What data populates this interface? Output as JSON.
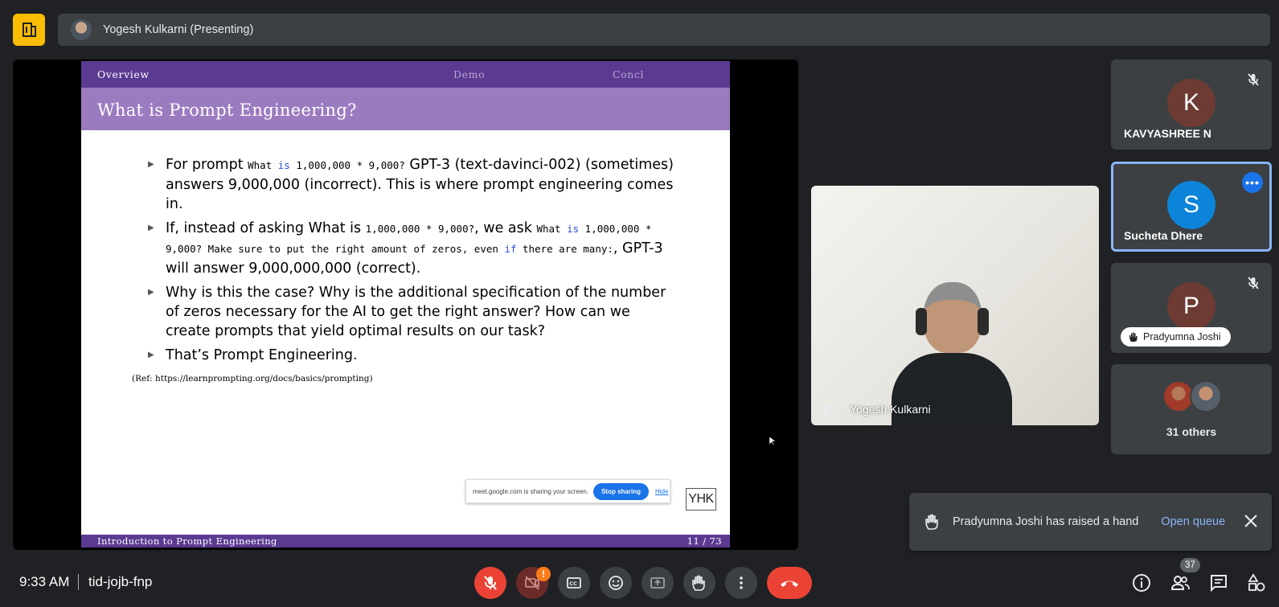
{
  "top_bar": {
    "presenter_label": "Yogesh Kulkarni (Presenting)"
  },
  "slide": {
    "nav": [
      "Overview",
      "Demo",
      "Concl"
    ],
    "title": "What is Prompt Engineering?",
    "bullet1": {
      "t1": "For prompt ",
      "c1": "What ",
      "k1": "is",
      "c2": " 1,000,000 * 9,000?",
      "t2": " GPT-3 (text-davinci-002) (sometimes) answers 9,000,000 (incorrect). This is where prompt engineering comes in."
    },
    "bullet2": {
      "t1": "If, instead of asking What is ",
      "c1": "1,000,000 * 9,000?",
      "t2": ", we ask ",
      "c2": "What ",
      "k1": "is",
      "c3": " 1,000,000 * 9,000? Make sure to put the right amount of zeros, even ",
      "k2": "if",
      "c4": " there are many:",
      "t3": ", GPT-3 will answer 9,000,000,000 (correct)."
    },
    "bullet3": "Why is this the case? Why is the additional specification of the number of zeros necessary for the AI to get the right answer? How can we create prompts that yield optimal results on our task?",
    "bullet4": "That’s Prompt Engineering.",
    "reference": "(Ref:  https://learnprompting.org/docs/basics/prompting)",
    "share_bar": {
      "text": "meet.google.com is sharing your screen.",
      "stop_label": "Stop sharing",
      "hide_label": "Hide"
    },
    "logo_text": "YHK",
    "footer_title": "Introduction to Prompt Engineering",
    "page_number": "11 / 73"
  },
  "video": {
    "name": "Yogesh Kulkarni"
  },
  "participants": [
    {
      "initial": "K",
      "name": "KAVYASHREE N",
      "color": "#6d3b33",
      "muted": true
    },
    {
      "initial": "S",
      "name": "Sucheta Dhere",
      "color": "#0b84d9",
      "muted": false
    },
    {
      "initial": "P",
      "name": "Pradyumna Joshi",
      "color": "#6d3b33",
      "muted": true
    }
  ],
  "others": {
    "label": "31 others"
  },
  "notification": {
    "message": "Pradyumna Joshi has raised a hand",
    "action": "Open queue"
  },
  "bottom_bar": {
    "time": "9:33 AM",
    "meeting_code": "tid-jojb-fnp",
    "participant_count": "37",
    "alert_badge": "!"
  },
  "colors": {
    "background": "#202124",
    "tile": "#3c4043",
    "accent_blue": "#8ab4f8",
    "end_call": "#ea4335",
    "logo_yellow": "#fbbc04",
    "slide_purple": "#5b3a91",
    "slide_title_purple": "#9b7bc0"
  },
  "icons": [
    "meet-logo-icon",
    "pin-icon",
    "mic-off-icon",
    "more-icon",
    "hand-icon",
    "close-icon",
    "camera-off-icon",
    "captions-icon",
    "emoji-icon",
    "present-icon",
    "raise-hand-icon",
    "more-vert-icon",
    "end-call-icon",
    "info-icon",
    "people-icon",
    "chat-icon",
    "activities-icon"
  ]
}
